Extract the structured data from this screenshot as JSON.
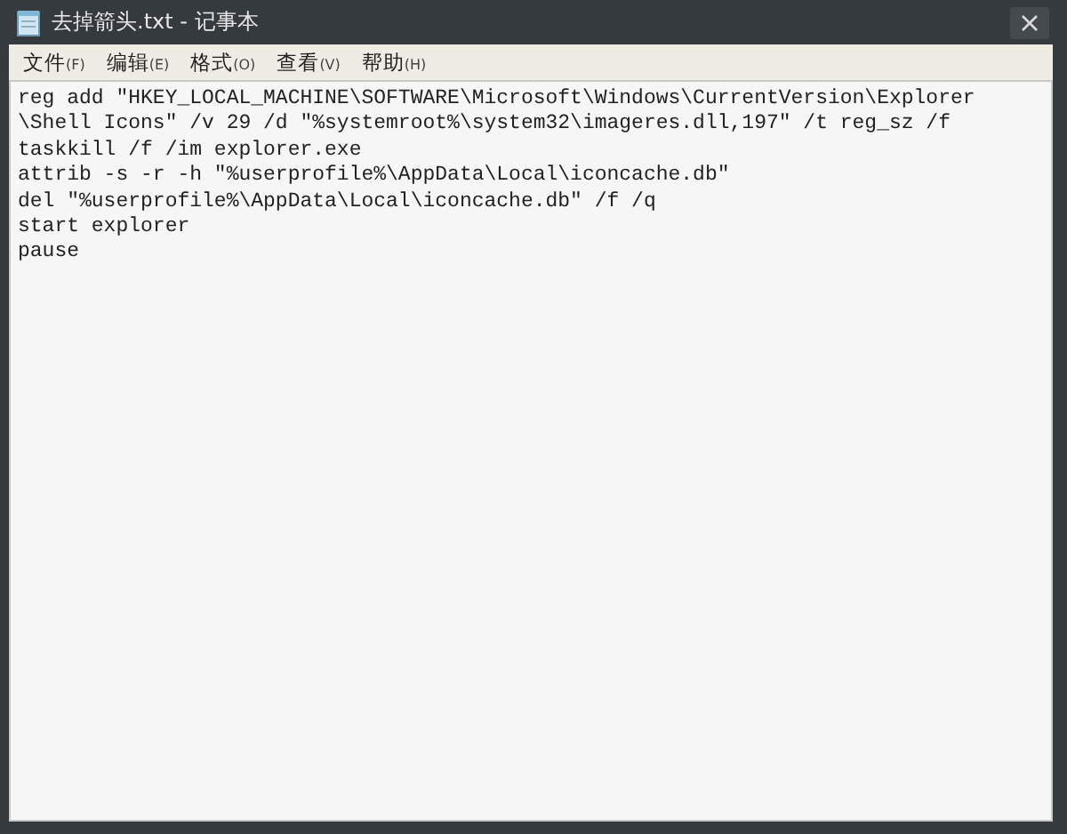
{
  "window": {
    "title": "去掉箭头.txt - 记事本"
  },
  "menu": [
    {
      "label": "文件",
      "key": "(F)"
    },
    {
      "label": "编辑",
      "key": "(E)"
    },
    {
      "label": "格式",
      "key": "(O)"
    },
    {
      "label": "查看",
      "key": "(V)"
    },
    {
      "label": "帮助",
      "key": "(H)"
    }
  ],
  "editor": {
    "lines": [
      "reg add \"HKEY_LOCAL_MACHINE\\SOFTWARE\\Microsoft\\Windows\\CurrentVersion\\Explorer",
      "\\Shell Icons\" /v 29 /d \"%systemroot%\\system32\\imageres.dll,197\" /t reg_sz /f",
      "taskkill /f /im explorer.exe",
      "attrib -s -r -h \"%userprofile%\\AppData\\Local\\iconcache.db\"",
      "del \"%userprofile%\\AppData\\Local\\iconcache.db\" /f /q",
      "start explorer",
      "pause"
    ]
  }
}
